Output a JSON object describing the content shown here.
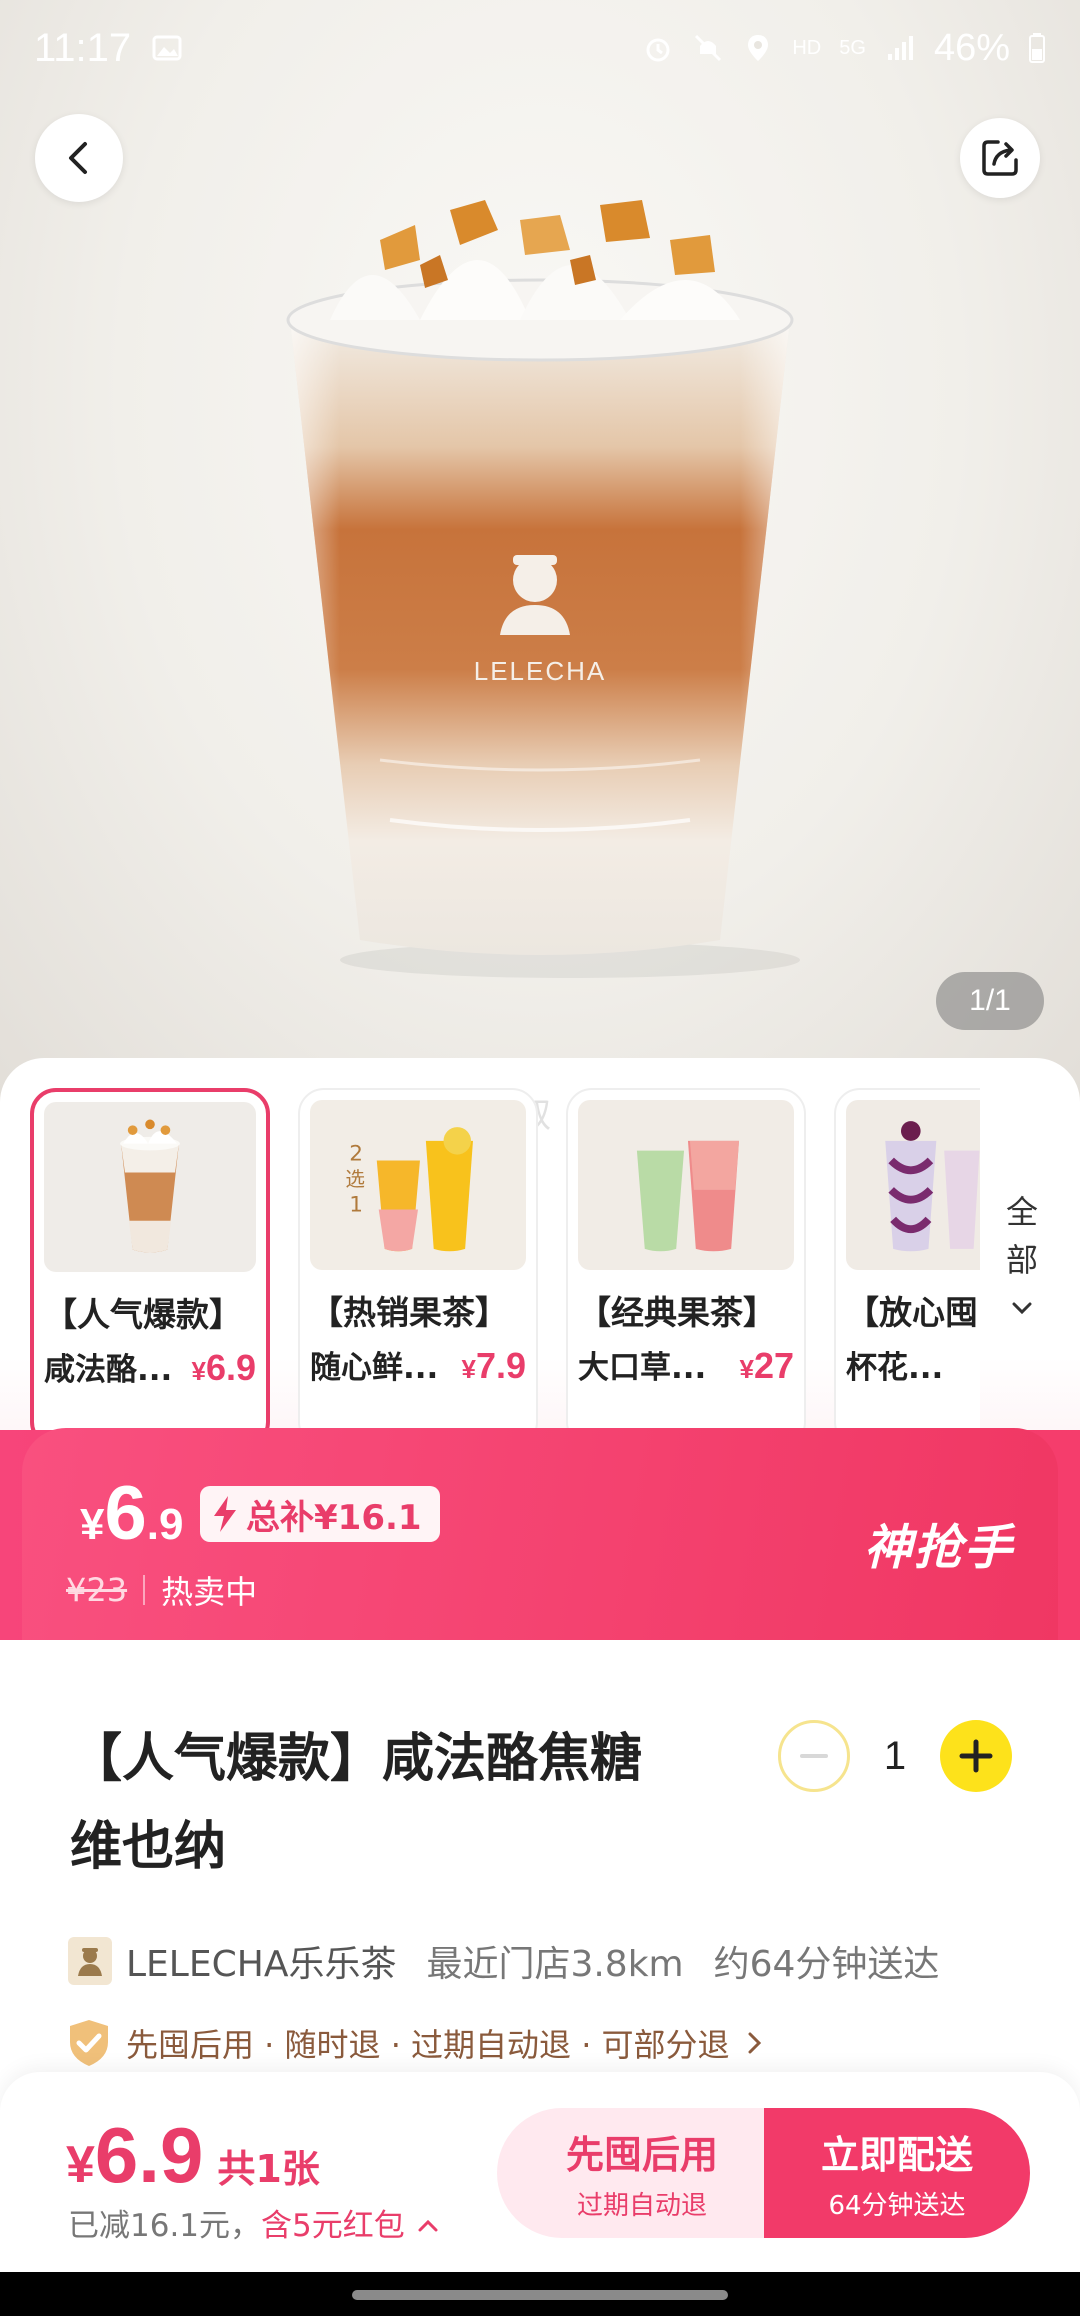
{
  "status_bar": {
    "time": "11:17",
    "battery": "46%",
    "network": "HD",
    "signal_label": "5G"
  },
  "hero": {
    "page_counter": "1/1",
    "cup_brand": "LELECHA"
  },
  "watermark": "山姆叔",
  "products": [
    {
      "line1": "【人气爆款】",
      "line2": "咸法酪...",
      "price_symbol": "¥",
      "price": "6.9",
      "selected": true
    },
    {
      "line1": "【热销果茶】",
      "line2": "随心鲜...",
      "price_symbol": "¥",
      "price": "7.9",
      "selected": false
    },
    {
      "line1": "【经典果茶】",
      "line2": "大口草...",
      "price_symbol": "¥",
      "price": "27",
      "selected": false
    },
    {
      "line1": "【放心囤",
      "line2": "杯花...",
      "price_symbol": "¥",
      "price": "",
      "selected": false
    }
  ],
  "thumb_badge": {
    "top": "2",
    "middle": "选",
    "bottom": "1"
  },
  "all_button": {
    "c1": "全",
    "c2": "部"
  },
  "promo": {
    "price_symbol": "¥",
    "price_int": "6",
    "price_dec": ".9",
    "subsidy": "总补¥16.1",
    "original_price": "¥23",
    "status": "热卖中",
    "badge": "神抢手"
  },
  "product": {
    "title_line1": "【人气爆款】咸法酪焦糖",
    "title_line2": "维也纳",
    "quantity": "1"
  },
  "store": {
    "name": "LELECHA乐乐茶",
    "distance": "最近门店3.8km",
    "delivery": "约64分钟送达",
    "guarantee": "先囤后用 · 随时退 · 过期自动退 · 可部分退"
  },
  "bottom": {
    "price_symbol": "¥",
    "price": "6.9",
    "count": "共1张",
    "discount_prefix": "已减16.1元，",
    "discount_red": "含5元红包",
    "left_btn": {
      "title": "先囤后用",
      "sub": "过期自动退"
    },
    "right_btn": {
      "title": "立即配送",
      "sub": "64分钟送达"
    }
  },
  "colors": {
    "accent": "#e93d6a",
    "plus_yellow": "#fde21b",
    "promo_pink": "#f23a69"
  }
}
